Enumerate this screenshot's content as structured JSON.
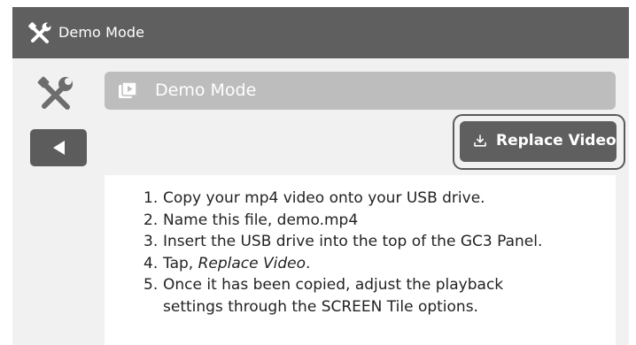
{
  "titlebar": {
    "icon": "tools-icon",
    "title": "Demo Mode"
  },
  "sidebar": {
    "icon": "tools-icon",
    "back_icon": "back-arrow-icon"
  },
  "section": {
    "icon": "video-icon",
    "label": "Demo Mode"
  },
  "replace_button": {
    "icon": "download-icon",
    "label": "Replace Video"
  },
  "instructions": [
    {
      "number": "1.",
      "text": "Copy your mp4 video onto your USB drive."
    },
    {
      "number": "2.",
      "text": "Name this file, demo.mp4"
    },
    {
      "number": "3.",
      "text": "Insert the USB drive into the top of the GC3 Panel."
    },
    {
      "number": "4.",
      "prefix": "Tap, ",
      "emphasis": "Replace Video",
      "suffix": "."
    },
    {
      "number": "5.",
      "text": "Once it has been copied, adjust the playback",
      "continuation": "settings through the SCREEN Tile options."
    }
  ],
  "colors": {
    "titlebar_bg": "#5f5f5f",
    "content_bg": "#f1f1f1",
    "section_bar_bg": "#bdbdbd",
    "button_bg": "#5f5f5f"
  }
}
